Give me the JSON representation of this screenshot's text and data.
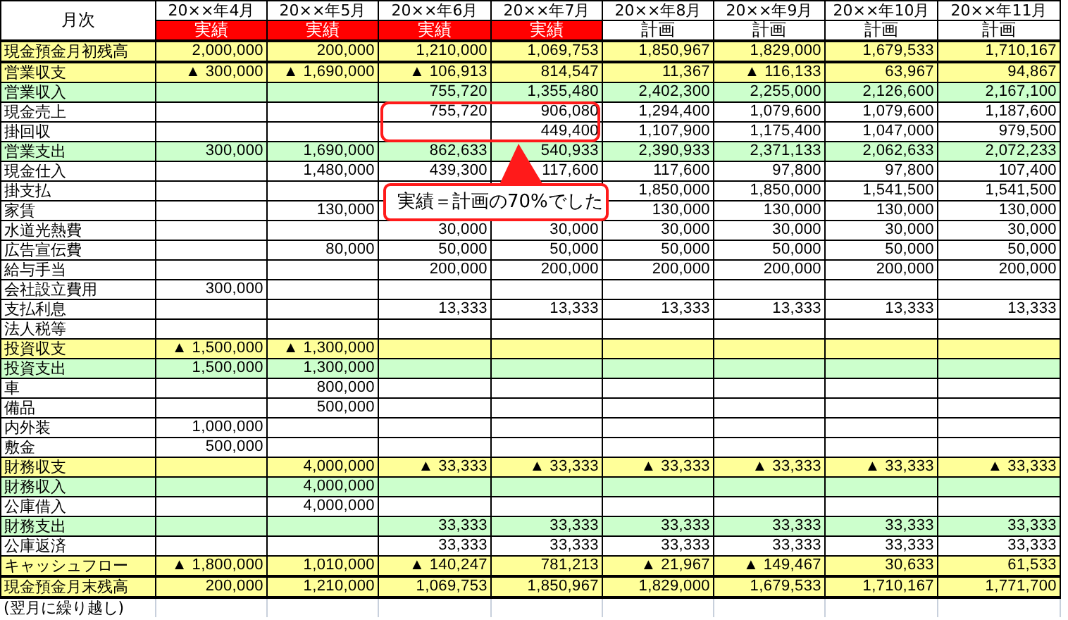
{
  "corner_label": "月次",
  "columns": [
    {
      "month": "20××年4月",
      "status": "実績",
      "kind": "actual"
    },
    {
      "month": "20××年5月",
      "status": "実績",
      "kind": "actual"
    },
    {
      "month": "20××年6月",
      "status": "実績",
      "kind": "actual"
    },
    {
      "month": "20××年7月",
      "status": "実績",
      "kind": "actual"
    },
    {
      "month": "20××年8月",
      "status": "計画",
      "kind": "plan"
    },
    {
      "month": "20××年9月",
      "status": "計画",
      "kind": "plan"
    },
    {
      "month": "20××年10月",
      "status": "計画",
      "kind": "plan"
    },
    {
      "month": "20××年11月",
      "status": "計画",
      "kind": "plan"
    }
  ],
  "rows": [
    {
      "label": "現金預金月初残高",
      "kind": "balance",
      "cells": [
        {
          "kind": "amount",
          "text": "2,000,000"
        },
        {
          "kind": "amount",
          "text": "200,000"
        },
        {
          "kind": "amount",
          "text": "1,210,000"
        },
        {
          "kind": "amount",
          "text": "1,069,753"
        },
        {
          "kind": "amount",
          "text": "1,850,967"
        },
        {
          "kind": "amount",
          "text": "1,829,000"
        },
        {
          "kind": "amount",
          "text": "1,679,533"
        },
        {
          "kind": "amount",
          "text": "1,710,167"
        }
      ]
    },
    {
      "label": "営業収支",
      "kind": "section",
      "cells": [
        {
          "kind": "amount",
          "text": "▲ 300,000"
        },
        {
          "kind": "amount",
          "text": "▲ 1,690,000"
        },
        {
          "kind": "amount",
          "text": "▲ 106,913"
        },
        {
          "kind": "amount",
          "text": "814,547"
        },
        {
          "kind": "amount",
          "text": "11,367"
        },
        {
          "kind": "amount",
          "text": "▲ 116,133"
        },
        {
          "kind": "amount",
          "text": "63,967"
        },
        {
          "kind": "amount",
          "text": "94,867"
        }
      ]
    },
    {
      "label": "営業収入",
      "kind": "subtotal",
      "cells": [
        {
          "kind": "blank"
        },
        {
          "kind": "blank"
        },
        {
          "kind": "amount",
          "text": "755,720"
        },
        {
          "kind": "amount",
          "text": "1,355,480"
        },
        {
          "kind": "amount",
          "text": "2,402,300"
        },
        {
          "kind": "amount",
          "text": "2,255,000"
        },
        {
          "kind": "amount",
          "text": "2,126,600"
        },
        {
          "kind": "amount",
          "text": "2,167,100"
        }
      ]
    },
    {
      "label": "現金売上",
      "kind": "item",
      "cells": [
        {
          "kind": "blank"
        },
        {
          "kind": "blank"
        },
        {
          "kind": "amount",
          "text": "755,720"
        },
        {
          "kind": "amount",
          "text": "906,080"
        },
        {
          "kind": "amount",
          "text": "1,294,400"
        },
        {
          "kind": "amount",
          "text": "1,079,600"
        },
        {
          "kind": "amount",
          "text": "1,079,600"
        },
        {
          "kind": "amount",
          "text": "1,187,600"
        }
      ]
    },
    {
      "label": "掛回収",
      "kind": "item",
      "cells": [
        {
          "kind": "blank"
        },
        {
          "kind": "blank"
        },
        {
          "kind": "blank"
        },
        {
          "kind": "amount",
          "text": "449,400"
        },
        {
          "kind": "amount",
          "text": "1,107,900"
        },
        {
          "kind": "amount",
          "text": "1,175,400"
        },
        {
          "kind": "amount",
          "text": "1,047,000"
        },
        {
          "kind": "amount",
          "text": "979,500"
        }
      ]
    },
    {
      "label": "営業支出",
      "kind": "subtotal",
      "cells": [
        {
          "kind": "amount",
          "text": "300,000"
        },
        {
          "kind": "amount",
          "text": "1,690,000"
        },
        {
          "kind": "amount",
          "text": "862,633"
        },
        {
          "kind": "amount",
          "text": "540,933"
        },
        {
          "kind": "amount",
          "text": "2,390,933"
        },
        {
          "kind": "amount",
          "text": "2,371,133"
        },
        {
          "kind": "amount",
          "text": "2,062,633"
        },
        {
          "kind": "amount",
          "text": "2,072,233"
        }
      ]
    },
    {
      "label": "現金仕入",
      "kind": "item",
      "cells": [
        {
          "kind": "blank"
        },
        {
          "kind": "amount",
          "text": "1,480,000"
        },
        {
          "kind": "amount",
          "text": "439,300"
        },
        {
          "kind": "amount",
          "text": "117,600"
        },
        {
          "kind": "amount",
          "text": "117,600"
        },
        {
          "kind": "amount",
          "text": "97,800"
        },
        {
          "kind": "amount",
          "text": "97,800"
        },
        {
          "kind": "amount",
          "text": "107,400"
        }
      ]
    },
    {
      "label": "掛支払",
      "kind": "item",
      "cells": [
        {
          "kind": "blank"
        },
        {
          "kind": "blank"
        },
        {
          "kind": "blank"
        },
        {
          "kind": "blank"
        },
        {
          "kind": "amount",
          "text": "1,850,000"
        },
        {
          "kind": "amount",
          "text": "1,850,000"
        },
        {
          "kind": "amount",
          "text": "1,541,500"
        },
        {
          "kind": "amount",
          "text": "1,541,500"
        }
      ]
    },
    {
      "label": "家賃",
      "kind": "item",
      "cells": [
        {
          "kind": "blank"
        },
        {
          "kind": "amount",
          "text": "130,000"
        },
        {
          "kind": "blank"
        },
        {
          "kind": "blank"
        },
        {
          "kind": "amount",
          "text": "130,000"
        },
        {
          "kind": "amount",
          "text": "130,000"
        },
        {
          "kind": "amount",
          "text": "130,000"
        },
        {
          "kind": "amount",
          "text": "130,000"
        }
      ]
    },
    {
      "label": "水道光熱費",
      "kind": "item",
      "cells": [
        {
          "kind": "blank"
        },
        {
          "kind": "blank"
        },
        {
          "kind": "amount",
          "text": "30,000"
        },
        {
          "kind": "amount",
          "text": "30,000"
        },
        {
          "kind": "amount",
          "text": "30,000"
        },
        {
          "kind": "amount",
          "text": "30,000"
        },
        {
          "kind": "amount",
          "text": "30,000"
        },
        {
          "kind": "amount",
          "text": "30,000"
        }
      ]
    },
    {
      "label": "広告宣伝費",
      "kind": "item",
      "cells": [
        {
          "kind": "blank"
        },
        {
          "kind": "amount",
          "text": "80,000"
        },
        {
          "kind": "amount",
          "text": "50,000"
        },
        {
          "kind": "amount",
          "text": "50,000"
        },
        {
          "kind": "amount",
          "text": "50,000"
        },
        {
          "kind": "amount",
          "text": "50,000"
        },
        {
          "kind": "amount",
          "text": "50,000"
        },
        {
          "kind": "amount",
          "text": "50,000"
        }
      ]
    },
    {
      "label": "給与手当",
      "kind": "item",
      "cells": [
        {
          "kind": "blank"
        },
        {
          "kind": "blank"
        },
        {
          "kind": "amount",
          "text": "200,000"
        },
        {
          "kind": "amount",
          "text": "200,000"
        },
        {
          "kind": "amount",
          "text": "200,000"
        },
        {
          "kind": "amount",
          "text": "200,000"
        },
        {
          "kind": "amount",
          "text": "200,000"
        },
        {
          "kind": "amount",
          "text": "200,000"
        }
      ]
    },
    {
      "label": "会社設立費用",
      "kind": "item",
      "cells": [
        {
          "kind": "amount",
          "text": "300,000"
        },
        {
          "kind": "blank"
        },
        {
          "kind": "blank"
        },
        {
          "kind": "blank"
        },
        {
          "kind": "blank"
        },
        {
          "kind": "blank"
        },
        {
          "kind": "blank"
        },
        {
          "kind": "blank"
        }
      ]
    },
    {
      "label": "支払利息",
      "kind": "item",
      "cells": [
        {
          "kind": "blank"
        },
        {
          "kind": "blank"
        },
        {
          "kind": "amount",
          "text": "13,333"
        },
        {
          "kind": "amount",
          "text": "13,333"
        },
        {
          "kind": "amount",
          "text": "13,333"
        },
        {
          "kind": "amount",
          "text": "13,333"
        },
        {
          "kind": "amount",
          "text": "13,333"
        },
        {
          "kind": "amount",
          "text": "13,333"
        }
      ]
    },
    {
      "label": "法人税等",
      "kind": "item",
      "cells": [
        {
          "kind": "blank"
        },
        {
          "kind": "blank"
        },
        {
          "kind": "blank"
        },
        {
          "kind": "blank"
        },
        {
          "kind": "blank"
        },
        {
          "kind": "blank"
        },
        {
          "kind": "blank"
        },
        {
          "kind": "blank"
        }
      ]
    },
    {
      "label": "投資収支",
      "kind": "section",
      "cells": [
        {
          "kind": "amount",
          "text": "▲ 1,500,000"
        },
        {
          "kind": "amount",
          "text": "▲ 1,300,000"
        },
        {
          "kind": "blank"
        },
        {
          "kind": "blank"
        },
        {
          "kind": "blank"
        },
        {
          "kind": "blank"
        },
        {
          "kind": "blank"
        },
        {
          "kind": "blank"
        }
      ]
    },
    {
      "label": "投資支出",
      "kind": "subtotal",
      "cells": [
        {
          "kind": "amount",
          "text": "1,500,000"
        },
        {
          "kind": "amount",
          "text": "1,300,000"
        },
        {
          "kind": "blank"
        },
        {
          "kind": "blank"
        },
        {
          "kind": "blank"
        },
        {
          "kind": "blank"
        },
        {
          "kind": "blank"
        },
        {
          "kind": "blank"
        }
      ]
    },
    {
      "label": "車",
      "kind": "item",
      "cells": [
        {
          "kind": "blank"
        },
        {
          "kind": "amount",
          "text": "800,000"
        },
        {
          "kind": "blank"
        },
        {
          "kind": "blank"
        },
        {
          "kind": "blank"
        },
        {
          "kind": "blank"
        },
        {
          "kind": "blank"
        },
        {
          "kind": "blank"
        }
      ]
    },
    {
      "label": "備品",
      "kind": "item",
      "cells": [
        {
          "kind": "blank"
        },
        {
          "kind": "amount",
          "text": "500,000"
        },
        {
          "kind": "blank"
        },
        {
          "kind": "blank"
        },
        {
          "kind": "blank"
        },
        {
          "kind": "blank"
        },
        {
          "kind": "blank"
        },
        {
          "kind": "blank"
        }
      ]
    },
    {
      "label": "内外装",
      "kind": "item",
      "cells": [
        {
          "kind": "amount",
          "text": "1,000,000"
        },
        {
          "kind": "blank"
        },
        {
          "kind": "blank"
        },
        {
          "kind": "blank"
        },
        {
          "kind": "blank"
        },
        {
          "kind": "blank"
        },
        {
          "kind": "blank"
        },
        {
          "kind": "blank"
        }
      ]
    },
    {
      "label": "敷金",
      "kind": "item",
      "cells": [
        {
          "kind": "amount",
          "text": "500,000"
        },
        {
          "kind": "blank"
        },
        {
          "kind": "blank"
        },
        {
          "kind": "blank"
        },
        {
          "kind": "blank"
        },
        {
          "kind": "blank"
        },
        {
          "kind": "blank"
        },
        {
          "kind": "blank"
        }
      ]
    },
    {
      "label": "財務収支",
      "kind": "section",
      "cells": [
        {
          "kind": "blank"
        },
        {
          "kind": "amount",
          "text": "4,000,000"
        },
        {
          "kind": "amount",
          "text": "▲ 33,333"
        },
        {
          "kind": "amount",
          "text": "▲ 33,333"
        },
        {
          "kind": "amount",
          "text": "▲ 33,333"
        },
        {
          "kind": "amount",
          "text": "▲ 33,333"
        },
        {
          "kind": "amount",
          "text": "▲ 33,333"
        },
        {
          "kind": "amount",
          "text": "▲ 33,333"
        }
      ]
    },
    {
      "label": "財務収入",
      "kind": "subtotal",
      "cells": [
        {
          "kind": "blank"
        },
        {
          "kind": "amount",
          "text": "4,000,000"
        },
        {
          "kind": "blank"
        },
        {
          "kind": "blank"
        },
        {
          "kind": "blank"
        },
        {
          "kind": "blank"
        },
        {
          "kind": "blank"
        },
        {
          "kind": "blank"
        }
      ]
    },
    {
      "label": "公庫借入",
      "kind": "item",
      "cells": [
        {
          "kind": "blank"
        },
        {
          "kind": "amount",
          "text": "4,000,000"
        },
        {
          "kind": "blank"
        },
        {
          "kind": "blank"
        },
        {
          "kind": "blank"
        },
        {
          "kind": "blank"
        },
        {
          "kind": "blank"
        },
        {
          "kind": "blank"
        }
      ]
    },
    {
      "label": "財務支出",
      "kind": "subtotal",
      "cells": [
        {
          "kind": "blank"
        },
        {
          "kind": "blank"
        },
        {
          "kind": "amount",
          "text": "33,333"
        },
        {
          "kind": "amount",
          "text": "33,333"
        },
        {
          "kind": "amount",
          "text": "33,333"
        },
        {
          "kind": "amount",
          "text": "33,333"
        },
        {
          "kind": "amount",
          "text": "33,333"
        },
        {
          "kind": "amount",
          "text": "33,333"
        }
      ]
    },
    {
      "label": "公庫返済",
      "kind": "item",
      "cells": [
        {
          "kind": "blank"
        },
        {
          "kind": "blank"
        },
        {
          "kind": "amount",
          "text": "33,333"
        },
        {
          "kind": "amount",
          "text": "33,333"
        },
        {
          "kind": "amount",
          "text": "33,333"
        },
        {
          "kind": "amount",
          "text": "33,333"
        },
        {
          "kind": "amount",
          "text": "33,333"
        },
        {
          "kind": "amount",
          "text": "33,333"
        }
      ]
    },
    {
      "label": "キャッシュフロー",
      "kind": "section",
      "cells": [
        {
          "kind": "amount",
          "text": "▲ 1,800,000"
        },
        {
          "kind": "amount",
          "text": "1,010,000"
        },
        {
          "kind": "amount",
          "text": "▲ 140,247"
        },
        {
          "kind": "amount",
          "text": "781,213"
        },
        {
          "kind": "amount",
          "text": "▲ 21,967"
        },
        {
          "kind": "amount",
          "text": "▲ 149,467"
        },
        {
          "kind": "amount",
          "text": "30,633"
        },
        {
          "kind": "amount",
          "text": "61,533"
        }
      ]
    },
    {
      "label": "現金預金月末残高",
      "kind": "balance",
      "cells": [
        {
          "kind": "amount",
          "text": "200,000"
        },
        {
          "kind": "amount",
          "text": "1,210,000"
        },
        {
          "kind": "amount",
          "text": "1,069,753"
        },
        {
          "kind": "amount",
          "text": "1,850,967"
        },
        {
          "kind": "amount",
          "text": "1,829,000"
        },
        {
          "kind": "amount",
          "text": "1,679,533"
        },
        {
          "kind": "amount",
          "text": "1,710,167"
        },
        {
          "kind": "amount",
          "text": "1,771,700"
        }
      ]
    }
  ],
  "footnote": "(翌月に繰り越し)",
  "callout": {
    "text": "実績＝計画の70%でした"
  }
}
